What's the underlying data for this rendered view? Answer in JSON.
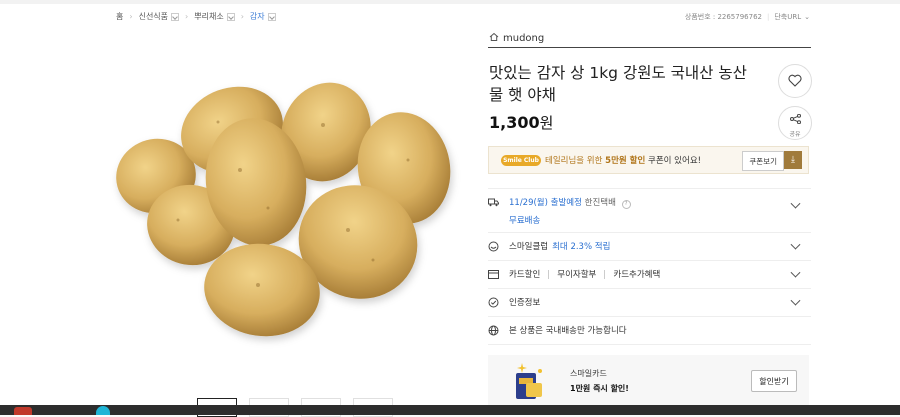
{
  "breadcrumb": {
    "home": "홈",
    "items": [
      "신선식품",
      "뿌리채소",
      "감자"
    ]
  },
  "product_meta": {
    "product_number": "상품번호 : 2265796762",
    "short_url": "단축URL"
  },
  "seller": {
    "name": "mudong"
  },
  "product": {
    "title": "맛있는 감자 상 1kg 강원도 국내산 농산물 햇 야채",
    "price": "1,300",
    "currency": "원"
  },
  "share": {
    "label": "공유"
  },
  "coupon": {
    "badge": "Smile Club",
    "text_pre": "테일리님을 위한 ",
    "text_highlight": "5만원 할인",
    "text_post": " 쿠폰이 있어요!",
    "button": "쿠폰보기"
  },
  "delivery": {
    "date": "11/29(월) 출발예정",
    "carrier": "한진택배",
    "free_shipping": "무료배송"
  },
  "smile_club": {
    "label": "스마일클럽",
    "rate": "최대 2.3% 적립"
  },
  "card": {
    "items": [
      "카드할인",
      "무이자할부",
      "카드추가혜택"
    ]
  },
  "certification": {
    "label": "인증정보"
  },
  "domestic_notice": "본 상품은 국내배송만 가능합니다",
  "promo": {
    "line1": "스마일카드",
    "line2": "1만원 즉시 할인!",
    "button": "할인받기"
  },
  "colors": {
    "accent_blue": "#2a6fd0",
    "coupon_gold": "#b07418",
    "club_badge": "#e8a928"
  }
}
